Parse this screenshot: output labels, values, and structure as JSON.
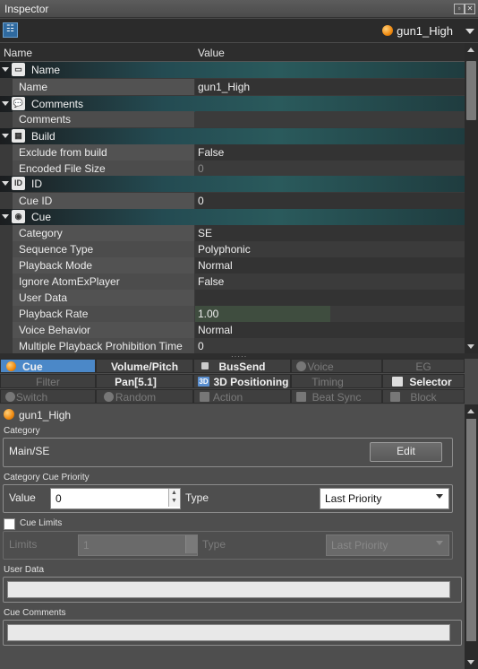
{
  "window": {
    "title": "Inspector"
  },
  "header": {
    "selected_item": "gun1_High"
  },
  "grid": {
    "col_name": "Name",
    "col_value": "Value",
    "sections": [
      {
        "label": "Name",
        "icon": "name-icon",
        "rows": [
          {
            "name": "Name",
            "value": "gun1_High"
          }
        ]
      },
      {
        "label": "Comments",
        "icon": "comments-icon",
        "rows": [
          {
            "name": "Comments",
            "value": ""
          }
        ]
      },
      {
        "label": "Build",
        "icon": "build-icon",
        "rows": [
          {
            "name": "Exclude from build",
            "value": "False"
          },
          {
            "name": "Encoded File Size",
            "value": "0"
          }
        ]
      },
      {
        "label": "ID",
        "icon": "id-icon",
        "rows": [
          {
            "name": "Cue ID",
            "value": "0"
          }
        ]
      },
      {
        "label": "Cue",
        "icon": "cue-icon",
        "rows": [
          {
            "name": "Category",
            "value": "SE"
          },
          {
            "name": "Sequence Type",
            "value": "Polyphonic"
          },
          {
            "name": "Playback Mode",
            "value": "Normal"
          },
          {
            "name": "Ignore AtomExPlayer",
            "value": "False"
          },
          {
            "name": "User Data",
            "value": ""
          },
          {
            "name": "Playback Rate",
            "value": "1.00"
          },
          {
            "name": "Voice Behavior",
            "value": "Normal"
          },
          {
            "name": "Multiple Playback Prohibition Time",
            "value": "0"
          }
        ]
      }
    ],
    "playback_rate_fill": 0.5
  },
  "tabs": {
    "row1": [
      "Cue",
      "Volume/Pitch",
      "BusSend",
      "Voice",
      "EG"
    ],
    "row2": [
      "Filter",
      "Pan[5.1]",
      "3D Positioning",
      "Timing",
      "Selector"
    ],
    "row3": [
      "Switch",
      "Random",
      "Action",
      "Beat Sync",
      "Block"
    ],
    "icon_3d": "3D"
  },
  "panel": {
    "item_name": "gun1_High",
    "category_label": "Category",
    "category_value": "Main/SE",
    "edit_button": "Edit",
    "priority_label": "Category Cue Priority",
    "value_label": "Value",
    "value_input": "0",
    "type_label": "Type",
    "type_select": "Last Priority",
    "cue_limits_label": "Cue Limits",
    "limits_label": "Limits",
    "limits_input": "1",
    "limits_type_label": "Type",
    "limits_type_select": "Last Priority",
    "user_data_label": "User Data",
    "user_data_value": "",
    "cue_comments_label": "Cue Comments",
    "cue_comments_value": ""
  },
  "colors": {
    "accent": "#4b88c8",
    "section_teal": "#2a5a5c"
  }
}
